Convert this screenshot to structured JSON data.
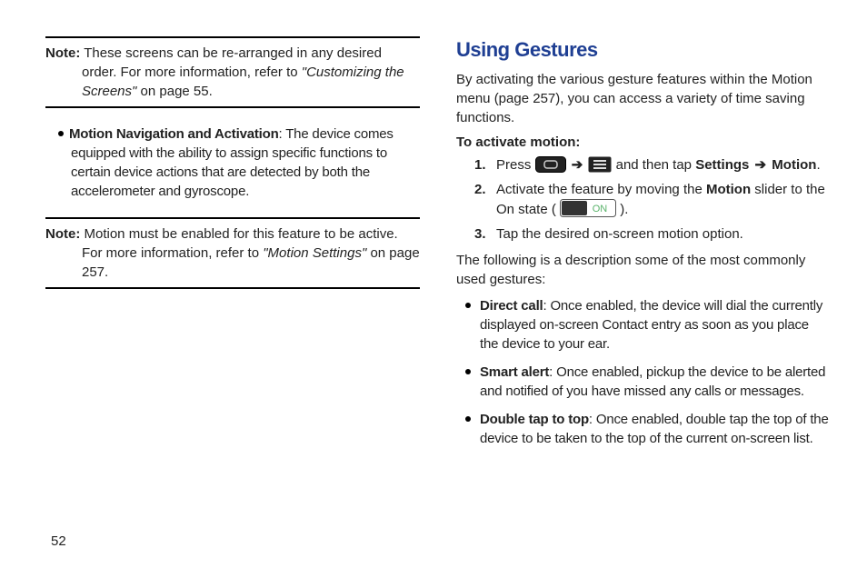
{
  "page_number": "52",
  "left": {
    "note1": {
      "label": "Note:",
      "text_a": "These screens can be re-arranged in any desired order. For more information, refer to ",
      "ref": "\"Customizing the Screens\"",
      "text_b": " on page 55."
    },
    "bullet": {
      "title": "Motion Navigation and Activation",
      "text": ": The device comes equipped with the ability to assign specific functions to certain device actions that are detected by both the accelerometer and gyroscope."
    },
    "note2": {
      "label": "Note:",
      "text_a": "Motion must be enabled for this feature to be active. For more information, refer to ",
      "ref": "\"Motion Settings\"",
      "text_b": " on page 257."
    }
  },
  "right": {
    "heading": "Using Gestures",
    "intro": "By activating the various gesture features within the Motion menu (page 257), you can access a variety of time saving functions.",
    "activate_label": "To activate motion:",
    "steps": {
      "s1_num": "1.",
      "s1_a": "Press ",
      "s1_b": " and then tap ",
      "s1_settings": "Settings",
      "s1_motion": "Motion",
      "s1_end": ".",
      "s2_num": "2.",
      "s2_a": "Activate the feature by moving the ",
      "s2_motion": "Motion",
      "s2_b": " slider to the On state ( ",
      "s2_c": " ).",
      "s3_num": "3.",
      "s3_a": "Tap the desired on-screen motion option."
    },
    "mid": "The following is a description some of the most commonly used gestures:",
    "features": {
      "f1_title": "Direct call",
      "f1_text": ": Once enabled, the device will dial the currently displayed on-screen Contact entry as soon as you place the device to your ear.",
      "f2_title": "Smart alert",
      "f2_text": ": Once enabled, pickup the device to be alerted and notified of you have missed any calls or messages.",
      "f3_title": "Double tap to top",
      "f3_text": ": Once enabled, double tap the top of the device to be taken to the top of the current on-screen list."
    },
    "arrow": "➔",
    "toggle_label": "ON"
  }
}
